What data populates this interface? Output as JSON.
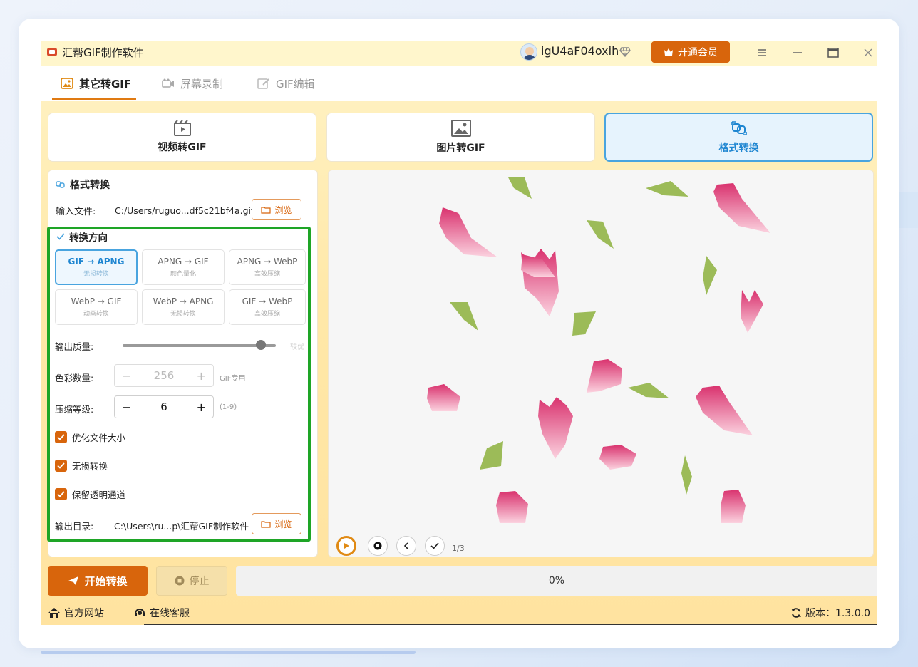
{
  "app": {
    "title": "汇帮GIF制作软件"
  },
  "user": {
    "name": "igU4aF04oxih"
  },
  "header": {
    "vip_label": "开通会员"
  },
  "tabs": [
    {
      "label": "其它转GIF",
      "icon": "image-icon"
    },
    {
      "label": "屏幕录制",
      "icon": "camera-icon"
    },
    {
      "label": "GIF编辑",
      "icon": "edit-icon"
    }
  ],
  "modes": [
    {
      "label": "视频转GIF",
      "icon": "video-icon"
    },
    {
      "label": "图片转GIF",
      "icon": "picture-icon"
    },
    {
      "label": "格式转换",
      "icon": "convert-icon"
    }
  ],
  "panel": {
    "title": "格式转换",
    "input_label": "输入文件:",
    "input_path": "C:/Users/ruguo...df5c21bf4a.gif",
    "browse_label": "浏览",
    "direction_title": "转换方向",
    "conversions": [
      {
        "main": "GIF → APNG",
        "sub": "无损转换"
      },
      {
        "main": "APNG → GIF",
        "sub": "颜色量化"
      },
      {
        "main": "APNG → WebP",
        "sub": "高效压缩"
      },
      {
        "main": "WebP → GIF",
        "sub": "动画转换"
      },
      {
        "main": "WebP → APNG",
        "sub": "无损转换"
      },
      {
        "main": "GIF → WebP",
        "sub": "高效压缩"
      }
    ],
    "quality_label": "输出质量:",
    "quality_hint": "较优",
    "quality_level": 0.88,
    "colors_label": "色彩数量:",
    "colors_value": "256",
    "colors_hint": "GIF专用",
    "compress_label": "压缩等级:",
    "compress_value": "6",
    "compress_hint": "(1-9)",
    "checkboxes": [
      {
        "label": "优化文件大小",
        "checked": true
      },
      {
        "label": "无损转换",
        "checked": true
      },
      {
        "label": "保留透明通道",
        "checked": true
      }
    ],
    "output_label": "输出目录:",
    "output_path": "C:\\Users\\ru...p\\汇帮GIF制作软件"
  },
  "preview": {
    "page_indicator": "1/3"
  },
  "actions": {
    "start_label": "开始转换",
    "stop_label": "停止",
    "progress": "0%"
  },
  "footer": {
    "website": "官方网站",
    "support": "在线客服",
    "version": "版本：1.3.0.0"
  },
  "colors": {
    "accent": "#d8650c",
    "active_blue": "#49a4df",
    "highlight_green": "#1ea526"
  }
}
